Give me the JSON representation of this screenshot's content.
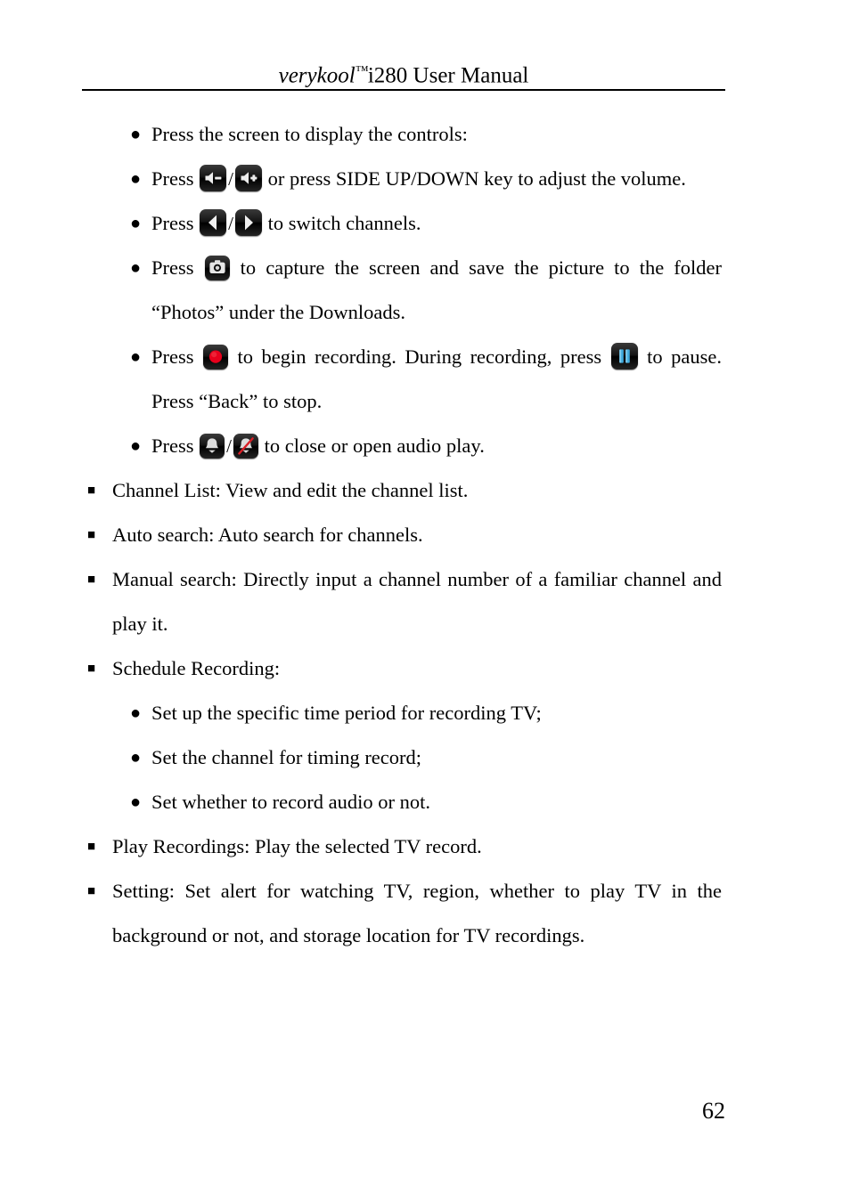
{
  "header": {
    "brand": "verykool",
    "trademark": "™",
    "model_title": "i280 User Manual"
  },
  "footer": {
    "page_number": "62"
  },
  "bullets": {
    "round": "●",
    "square": "■",
    "separator": "/"
  },
  "controls_list": {
    "item1": "Press the screen to display the controls:",
    "item2_before": "Press",
    "item2_after": "or press SIDE UP/DOWN key to adjust the volume.",
    "item3_before": "Press",
    "item3_after": "to switch channels.",
    "item4_before": "Press",
    "item4_after": "to capture the screen and save the picture to the folder “Photos” under the Downloads.",
    "item5_before": "Press",
    "item5_middle": "to begin recording.   During recording, press",
    "item5_after": "to pause. Press “Back” to stop.",
    "item6_before": "Press",
    "item6_after": "to close or open audio play."
  },
  "icons": {
    "volume_down": "volume-down-icon",
    "volume_up": "volume-up-icon",
    "channel_prev": "channel-previous-icon",
    "channel_next": "channel-next-icon",
    "capture": "camera-capture-icon",
    "record": "record-icon",
    "pause": "pause-icon",
    "audio_on": "bell-audio-on-icon",
    "audio_off": "bell-audio-off-icon"
  },
  "colors": {
    "icon_background": "#0d0d0d",
    "record_red": "#e8001c",
    "pause_blue": "#3fa9dd",
    "mute_slash_red": "#d81f26",
    "text": "#000000",
    "page_background": "#ffffff"
  },
  "menu_items": {
    "channel_list": "Channel List: View and edit the channel list.",
    "auto_search": "Auto search: Auto search for channels.",
    "manual_search": "Manual search: Directly input a channel number of a familiar channel and play it.",
    "schedule_recording": "Schedule Recording:",
    "play_recordings": "Play Recordings: Play the selected TV record.",
    "setting": "Setting: Set alert for watching TV, region, whether to play TV in the background or not, and storage location for TV recordings."
  },
  "schedule_sub_items": [
    "Set up the specific time period for recording TV;",
    "Set the channel for timing record;",
    "Set whether to record audio or not."
  ]
}
